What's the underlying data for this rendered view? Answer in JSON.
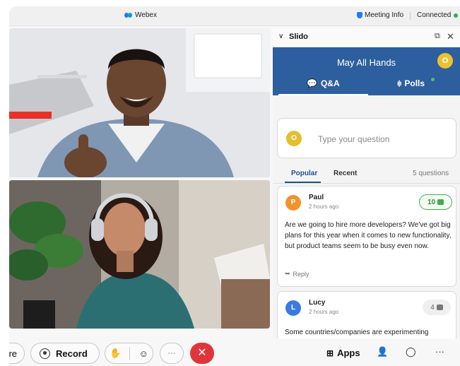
{
  "titlebar": {
    "app_name": "Webex",
    "meeting_info": "Meeting Info",
    "status": "Connected"
  },
  "slido": {
    "title": "Slido",
    "event_name": "May All Hands",
    "user_initial": "O",
    "tabs": {
      "qa": "Q&A",
      "polls": "Polls"
    },
    "ask_placeholder": "Type your question",
    "sort_tabs": {
      "popular": "Popular",
      "recent": "Recent"
    },
    "question_count": "5 questions",
    "questions": [
      {
        "initial": "P",
        "author": "Paul",
        "time": "2 hours ago",
        "likes": "10",
        "avatar_color": "#f0932b",
        "text": "Are we going to hire more developers? We've got big plans for this year when it comes to new functionality, but product teams seem to be busy even now.",
        "reply_label": "Reply"
      },
      {
        "initial": "L",
        "author": "Lucy",
        "time": "2 hours ago",
        "likes": "4",
        "avatar_color": "#3b7be0",
        "text": "Some countries/companies are experimenting"
      }
    ]
  },
  "toolbar": {
    "share_label": "re",
    "record_label": "Record",
    "apps_label": "Apps"
  },
  "colors": {
    "banner": "#2d5f9e",
    "accent_yellow": "#ecc232",
    "end_call": "#e0353b",
    "connected_green": "#2bb04a"
  }
}
